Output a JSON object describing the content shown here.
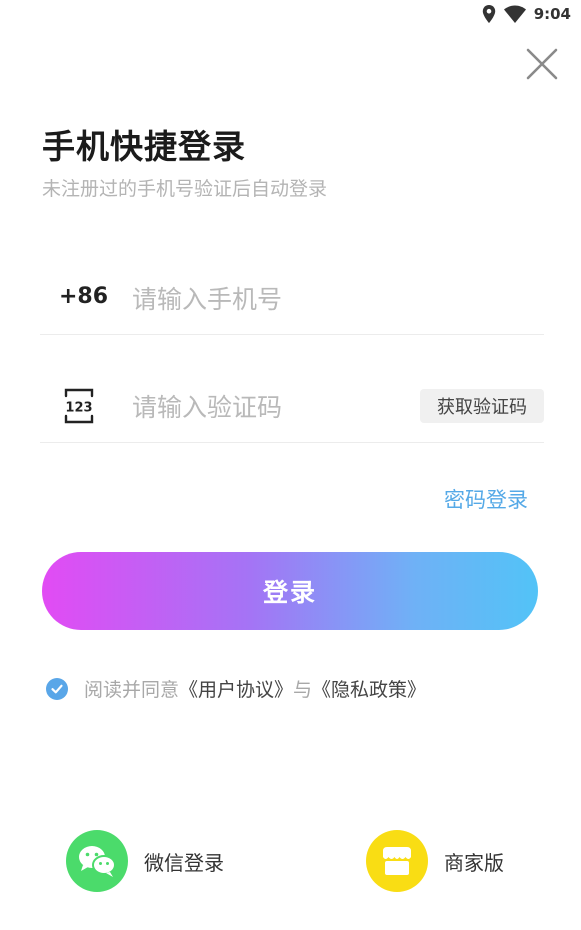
{
  "status": {
    "time": "9:04"
  },
  "header": {
    "title": "手机快捷登录",
    "subtitle": "未注册过的手机号验证后自动登录"
  },
  "phone": {
    "prefix": "+86",
    "placeholder": "请输入手机号"
  },
  "code": {
    "placeholder": "请输入验证码",
    "get_code_label": "获取验证码",
    "icon_text": "123"
  },
  "password_login_label": "密码登录",
  "login_button_label": "登录",
  "agreement": {
    "checked": true,
    "prefix": "阅读并同意",
    "user_agreement": "《用户协议》",
    "joiner": "与",
    "privacy_policy": "《隐私政策》"
  },
  "bottom": {
    "wechat_label": "微信登录",
    "merchant_label": "商家版"
  },
  "colors": {
    "accent_blue": "#55a9e7",
    "gradient_start": "#e24bf4",
    "gradient_end": "#52c3f7",
    "wechat_green": "#4bdb6b",
    "merchant_yellow": "#f9dd14"
  }
}
